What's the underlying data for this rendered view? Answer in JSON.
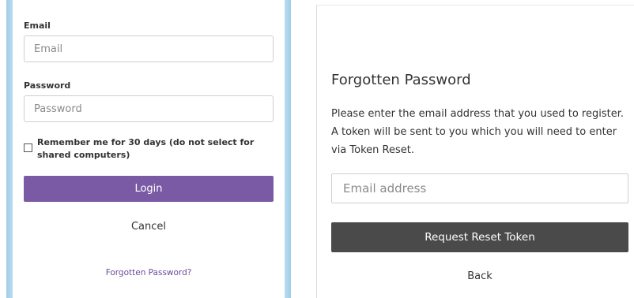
{
  "login": {
    "email_label": "Email",
    "email_placeholder": "Email",
    "password_label": "Password",
    "password_placeholder": "Password",
    "remember_label": "Remember me for 30 days (do not select for shared computers)",
    "remember_checked": false,
    "login_label": "Login",
    "cancel_label": "Cancel",
    "forgot_label": "Forgotten Password?"
  },
  "forgot": {
    "title": "Forgotten Password",
    "description": "Please enter the email address that you used to register. A token will be sent to you which you will need to enter via Token Reset.",
    "email_placeholder": "Email address",
    "request_label": "Request Reset Token",
    "back_label": "Back"
  },
  "colors": {
    "login_button": "#7a5aa5",
    "request_button": "#4a4a4a",
    "frame_blue": "#9fcde6",
    "forgot_link": "#6b4d9a"
  }
}
